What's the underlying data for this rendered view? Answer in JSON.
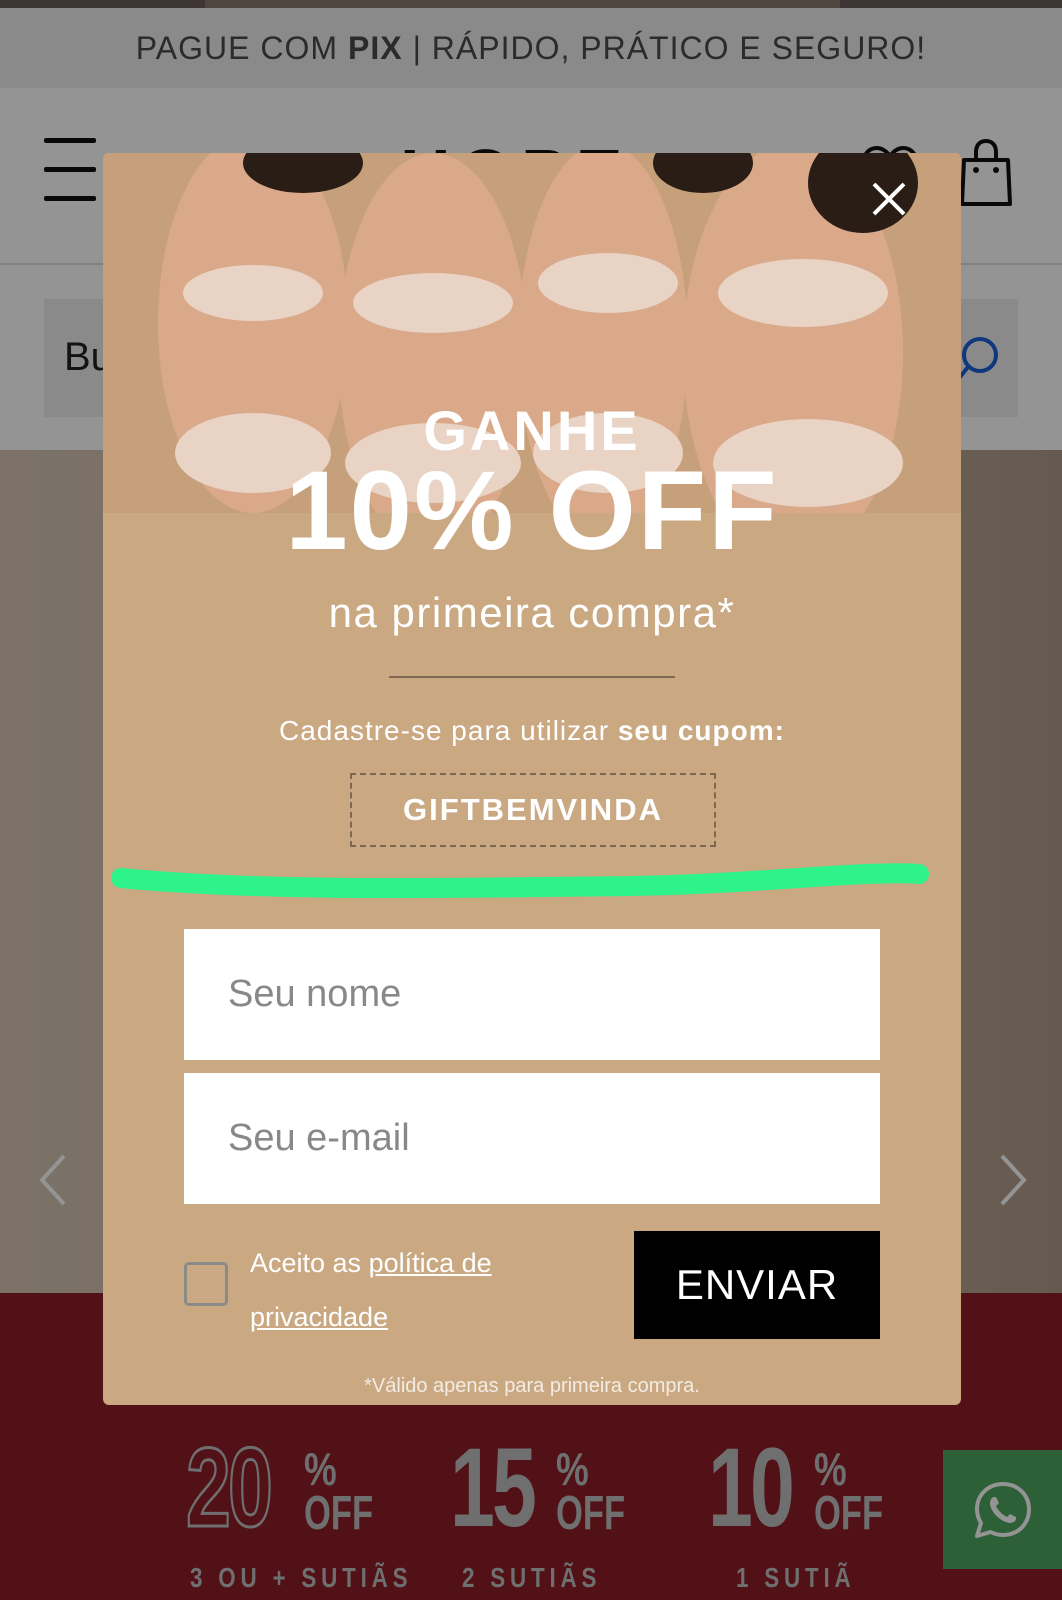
{
  "promo_bar": {
    "text_before": "PAGUE COM",
    "text_bold": "PIX",
    "text_after": "| RÁPIDO, PRÁTICO E SEGURO!"
  },
  "header": {
    "logo": "HOPE"
  },
  "search": {
    "placeholder": "Bu"
  },
  "banner": {
    "offers": [
      {
        "number": "20",
        "percent": "%",
        "off": "OFF",
        "label": "3 OU + SUTIÃS"
      },
      {
        "number": "15",
        "percent": "%",
        "off": "OFF",
        "label": "2 SUTIÃS"
      },
      {
        "number": "10",
        "percent": "%",
        "off": "OFF",
        "label": "1 SUTIÃ"
      }
    ]
  },
  "modal": {
    "headline_top": "GANHE",
    "headline_discount": "10% OFF",
    "subtitle": "na primeira compra*",
    "signup_text": "Cadastre-se para utilizar",
    "signup_bold": "seu cupom:",
    "coupon_code": "GIFTBEMVINDA",
    "name_placeholder": "Seu nome",
    "email_placeholder": "Seu e-mail",
    "privacy_prefix": "Aceito as",
    "privacy_link": "política de privacidade",
    "submit_label": "ENVIAR",
    "footnote": "*Válido apenas para primeira compra."
  },
  "colors": {
    "modal_background": "#c9a882",
    "highlight_stroke": "#2ef28a",
    "banner_red": "#8e1e26",
    "whatsapp_green": "#4fa55f",
    "submit_background": "#000000"
  },
  "icons": [
    "menu-icon",
    "heart-icon",
    "bag-icon",
    "search-icon",
    "close-icon",
    "chevron-left-icon",
    "chevron-right-icon",
    "whatsapp-icon"
  ]
}
